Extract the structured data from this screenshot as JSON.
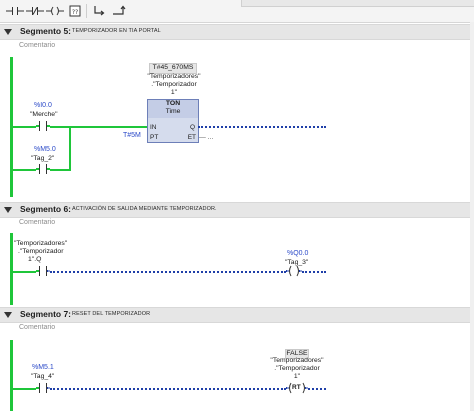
{
  "toolbar": {
    "buttons": [
      {
        "icon": "no-contact-icon",
        "glyph": "⊣⊢"
      },
      {
        "icon": "nc-contact-icon",
        "glyph": "⊣/⊢"
      },
      {
        "icon": "coil-icon",
        "glyph": "-( )-"
      },
      {
        "icon": "empty-box-icon",
        "glyph": "??"
      },
      {
        "icon": "open-branch-icon",
        "glyph": "↳"
      },
      {
        "icon": "close-branch-icon",
        "glyph": "↵"
      }
    ]
  },
  "comment_placeholder": "Comentario",
  "segments": [
    {
      "title": "Segmento 5:",
      "description": "TEMPORIZADOR EN TIA PORTAL",
      "contact1": {
        "address": "%I0.0",
        "name": "\"Merche\""
      },
      "contact2": {
        "address": "%M5.0",
        "name": "\"Tag_2\""
      },
      "timer": {
        "badge": "T#45_670MS",
        "instance_lines": [
          "\"Temporizadores\"",
          ".\"Temporizador",
          "1\""
        ],
        "type": "TON",
        "subtitle": "Time",
        "pin_in": "IN",
        "pin_pt": "PT",
        "pin_q": "Q",
        "pin_et": "ET",
        "pt_value": "T#5M",
        "et_value": "—  ..."
      }
    },
    {
      "title": "Segmento 6:",
      "description": "ACTIVACIÓN DE SALIDA MEDIANTE TEMPORIZADOR.",
      "contact": {
        "lines": [
          "\"Temporizadores\"",
          ".\"Temporizador",
          "1\".Q"
        ]
      },
      "coil": {
        "address": "%Q0.0",
        "name": "\"Tag_3\""
      }
    },
    {
      "title": "Segmento 7:",
      "description": "RESET DEL TEMPORIZADOR",
      "contact": {
        "address": "%M5.1",
        "name": "\"Tag_4\""
      },
      "reset": {
        "badge": "FALSE",
        "lines": [
          "\"Temporizadores\"",
          ".\"Temporizador",
          "1\""
        ],
        "coil_label": "RT"
      }
    }
  ]
}
